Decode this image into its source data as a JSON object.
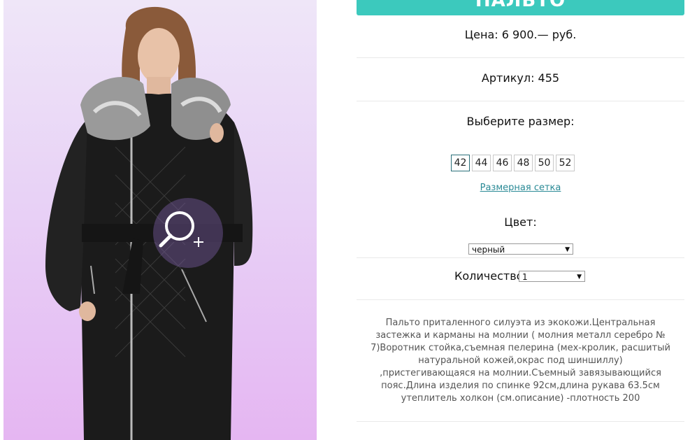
{
  "product": {
    "title": "ПАЛЬТО",
    "price": "Цена: 6 900.— руб.",
    "sku": "Артикул: 455",
    "size_label": "Выберите размер:",
    "sizes": [
      "42",
      "44",
      "46",
      "48",
      "50",
      "52"
    ],
    "selected_size": "42",
    "size_chart_link": "Размерная сетка",
    "color_label": "Цвет:",
    "color_value": "черный",
    "quantity_label": "Количество:",
    "quantity_value": "1",
    "description": "Пальто приталенного силуэта из экокожи.Центральная застежка и карманы на молнии ( молния металл серебро № 7)Воротник стойка,съемная пелерина (мех-кролик, расшитый натуральной кожей,окрас под шиншиллу) ,пристегивающаяся на молнии.Съемный завязывающийся пояс.Длина изделия по спинке 92см,длина рукава 63.5см утеплитель холкон (см.описание) -плотность 200"
  },
  "icons": {
    "zoom": "zoom-in-magnifier-icon",
    "dropdown": "triangle-down-icon"
  },
  "colors": {
    "accent": "#3cc9bd",
    "link": "#2a8a96",
    "selected_border": "#2a6f7a"
  }
}
